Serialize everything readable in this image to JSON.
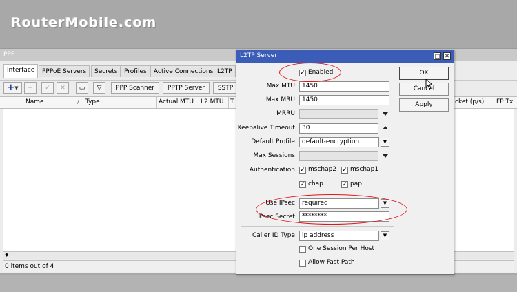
{
  "banner": {
    "logo_text": "RouterMobile.com"
  },
  "ppp": {
    "title": "PPP",
    "tabs": [
      "Interface",
      "PPPoE Servers",
      "Secrets",
      "Profiles",
      "Active Connections",
      "L2TP"
    ],
    "toolbar": {
      "scanner": "PPP Scanner",
      "pptp": "PPTP Server",
      "sstp": "SSTP"
    },
    "columns": [
      "Name",
      "Type",
      "Actual MTU",
      "L2 MTU",
      "T",
      "cket (p/s)",
      "FP Tx"
    ],
    "status": "0 items out of 4"
  },
  "dialog": {
    "title": "L2TP Server",
    "enabled_label": "Enabled",
    "buttons": {
      "ok": "OK",
      "cancel": "Cancel",
      "apply": "Apply"
    },
    "fields": {
      "max_mtu": {
        "label": "Max MTU:",
        "value": "1450"
      },
      "max_mru": {
        "label": "Max MRU:",
        "value": "1450"
      },
      "mrru": {
        "label": "MRRU:",
        "value": ""
      },
      "keepalive": {
        "label": "Keepalive Timeout:",
        "value": "30"
      },
      "default_profile": {
        "label": "Default Profile:",
        "value": "default-encryption"
      },
      "max_sessions": {
        "label": "Max Sessions:",
        "value": ""
      },
      "authentication": {
        "label": "Authentication:"
      },
      "use_ipsec": {
        "label": "Use IPsec:",
        "value": "required"
      },
      "ipsec_secret": {
        "label": "IPsec Secret:",
        "value": "********"
      },
      "caller_id": {
        "label": "Caller ID Type:",
        "value": "ip address"
      }
    },
    "auth": {
      "mschap2": "mschap2",
      "mschap1": "mschap1",
      "chap": "chap",
      "pap": "pap"
    },
    "one_session_label": "One Session Per Host",
    "allow_fast_path_label": "Allow Fast Path"
  },
  "colors": {
    "title_bar": "#3b5db7",
    "annotation": "#e0141a"
  }
}
